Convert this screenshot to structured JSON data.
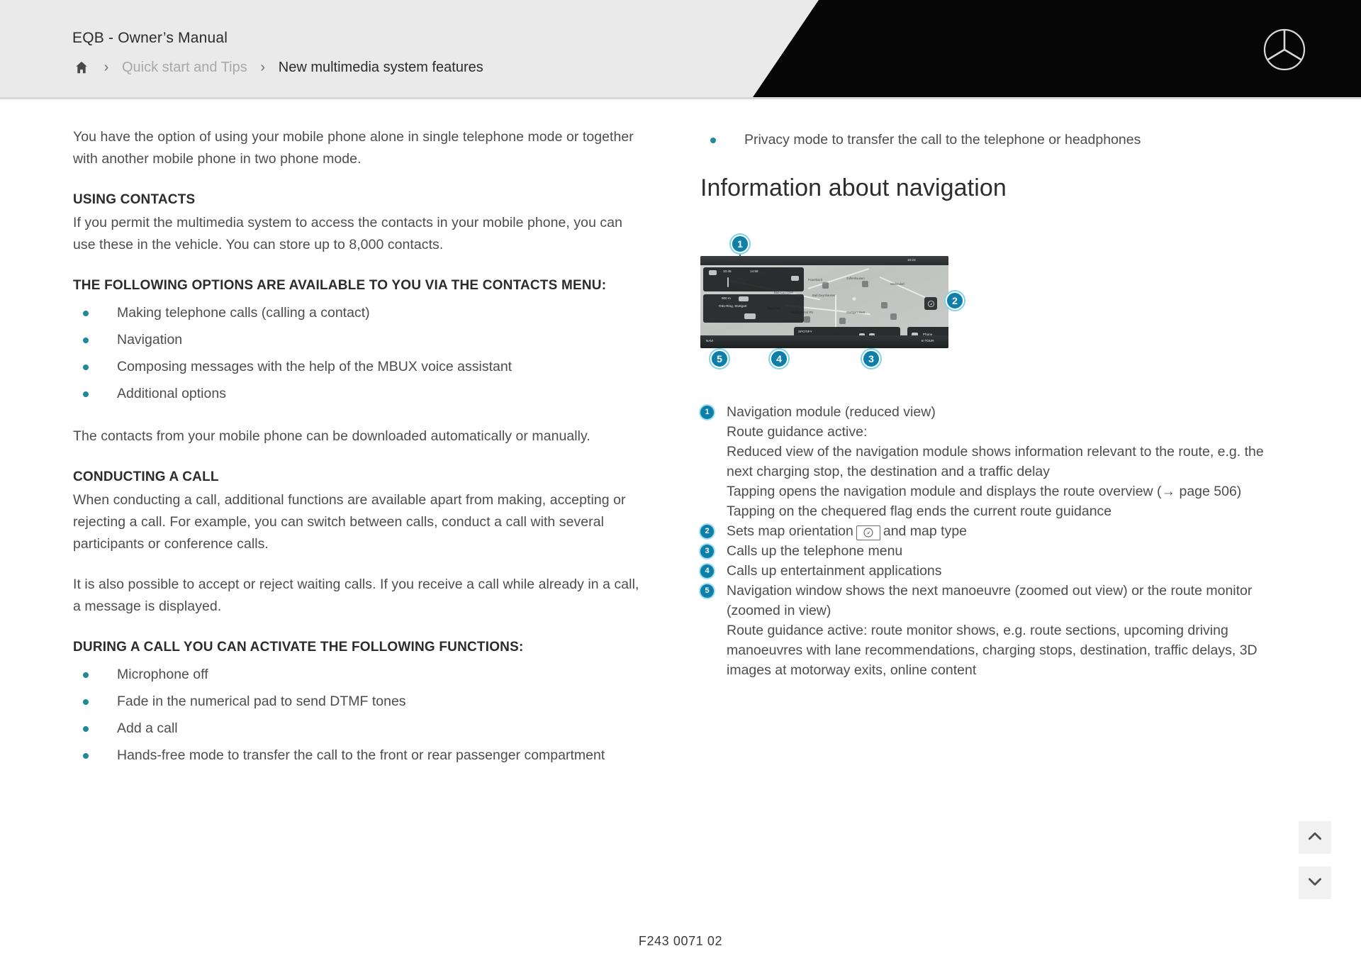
{
  "header": {
    "manual_title": "EQB - Owner’s Manual",
    "breadcrumb": {
      "home_icon": "home-icon",
      "separator": "›",
      "parent": "Quick start and Tips",
      "current": "New multimedia system features"
    },
    "brand_logo": "mercedes-benz-star-icon"
  },
  "left_column": {
    "intro_paragraph": "You have the option of using your mobile phone alone in single telephone mode or together with another mobile phone in two phone mode.",
    "using_contacts": {
      "heading": "USING CONTACTS",
      "body": "If you permit the multimedia system to access the contacts in your mobile phone, you can use these in the vehicle. You can store up to 8,000 contacts."
    },
    "contacts_menu": {
      "heading": "THE FOLLOWING OPTIONS ARE AVAILABLE TO YOU VIA THE CONTACTS MENU:",
      "items": [
        "Making telephone calls (calling a contact)",
        "Navigation",
        "Composing messages with the help of the MBUX voice assistant",
        "Additional options"
      ]
    },
    "download_note": "The contacts from your mobile phone can be downloaded automatically or manually.",
    "conducting_a_call": {
      "heading": "CONDUCTING A CALL",
      "paragraph_1": "When conducting a call, additional functions are available apart from making, accepting or rejecting a call. For example, you can switch between calls, conduct a call with several participants or conference calls.",
      "paragraph_2": "It is also possible to accept or reject waiting calls. If you receive a call while already in a call, a message is displayed."
    },
    "during_call": {
      "heading": "DURING A CALL YOU CAN ACTIVATE THE FOLLOWING FUNCTIONS:",
      "items": [
        "Microphone off",
        "Fade in the numerical pad to send DTMF tones",
        "Add a call",
        "Hands-free mode to transfer the call to the front or rear passenger compartment"
      ]
    }
  },
  "right_column": {
    "top_bullet": "Privacy mode to transfer the call to the telephone or headphones",
    "section_heading": "Information about navigation",
    "figure": {
      "name": "mbux-navigation-screen",
      "callouts": [
        "1",
        "2",
        "3",
        "4",
        "5"
      ],
      "screen": {
        "status_time": "10:23",
        "home_icon": "home-icon",
        "route_eta_label": "10:45",
        "route_arrive_label": "14:58",
        "distance_label": "900 m",
        "street_label": "Otto-Ring, Stuttgart",
        "media_label": "SPOTIFY",
        "phone_label": "Phone",
        "nav_label": "NAVI",
        "zoom_label": "E-TOUR"
      }
    },
    "legend": [
      {
        "num": "1",
        "lines": [
          "Navigation module (reduced view)",
          "Route guidance active:",
          "Reduced view of the navigation module shows information relevant to the route, e.g. the next charging stop, the destination and a traffic delay",
          "Tapping opens the navigation module and displays the route overview (→ page 506)",
          "Tapping on the chequered flag ends the current route guidance"
        ]
      },
      {
        "num": "2",
        "text_before": "Sets map orientation",
        "inline_icon": "map-orientation-compass-icon",
        "text_after": "and map type"
      },
      {
        "num": "3",
        "lines": [
          "Calls up the telephone menu"
        ]
      },
      {
        "num": "4",
        "lines": [
          "Calls up entertainment applications"
        ]
      },
      {
        "num": "5",
        "lines": [
          "Navigation window shows the next manoeuvre (zoomed out view) or the route monitor (zoomed in view)",
          "Route guidance active: route monitor shows, e.g. route sections, upcoming driving manoeuvres with lane recommendations, charging stops, destination, traffic delays, 3D images at motorway exits, online content"
        ]
      }
    ]
  },
  "controls": {
    "scroll_up_icon": "chevron-up-icon",
    "scroll_down_icon": "chevron-down-icon"
  },
  "footer": {
    "document_code": "F243 0071 02"
  },
  "colors": {
    "accent_blue": "#0d7fa8",
    "accent_blue_halo": "#7fd4ea",
    "bullet_teal": "#1f8a94",
    "header_gray": "#eaeaea",
    "header_black": "#060606",
    "body_text": "#4d4d4d"
  }
}
